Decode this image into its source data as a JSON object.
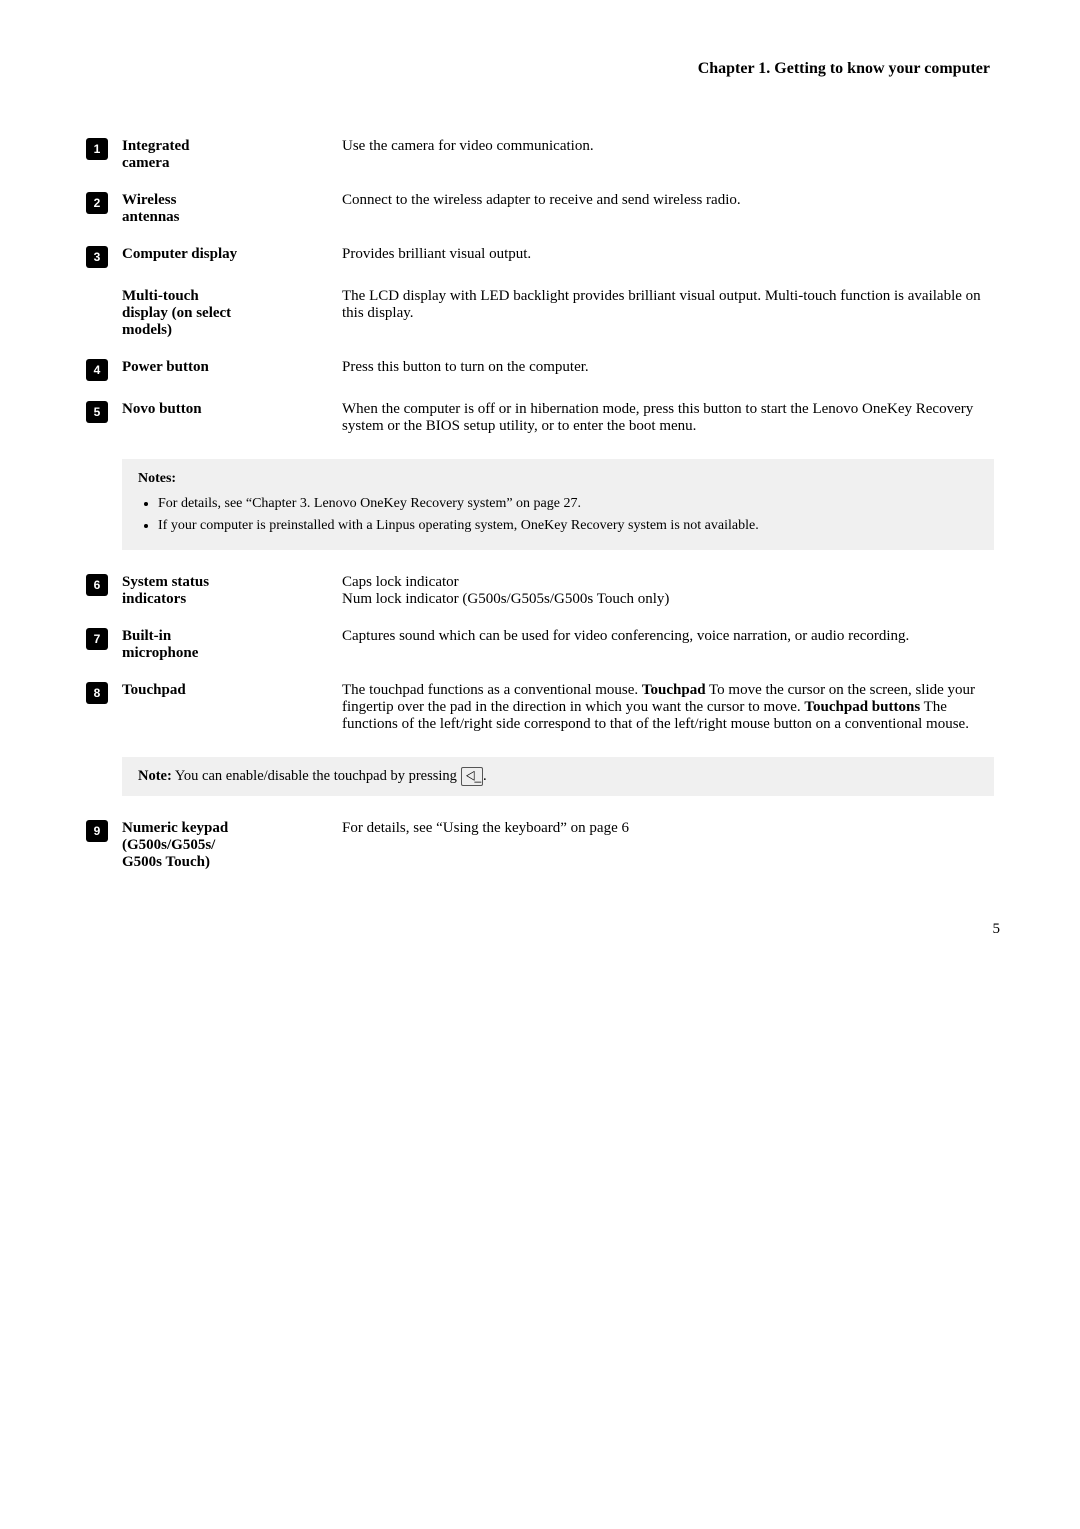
{
  "header": {
    "title": "Chapter 1. Getting to know your computer"
  },
  "items": [
    {
      "badge": "1",
      "term_line1": "Integrated",
      "term_line2": "camera",
      "desc": "Use the camera for video communication."
    },
    {
      "badge": "2",
      "term_line1": "Wireless",
      "term_line2": "antennas",
      "desc": "Connect to the wireless adapter to receive and send wireless radio."
    },
    {
      "badge": "3",
      "term_line1": "Computer display",
      "term_line2": "",
      "desc": "Provides brilliant visual output."
    },
    {
      "badge": "",
      "term_line1": "Multi-touch",
      "term_line2": "display (on select",
      "term_line3": "models)",
      "desc": "The LCD display with LED backlight provides brilliant visual output. Multi-touch function is available on this display."
    },
    {
      "badge": "4",
      "term_line1": "Power button",
      "term_line2": "",
      "desc": "Press this button to turn on the computer."
    },
    {
      "badge": "5",
      "term_line1": "Novo button",
      "term_line2": "",
      "desc": "When the computer is off or in hibernation mode, press this button to start the Lenovo OneKey Recovery system or the BIOS setup utility, or to enter the boot menu."
    }
  ],
  "notes": {
    "title": "Notes:",
    "bullets": [
      "For details, see “Chapter 3. Lenovo OneKey Recovery system” on page 27.",
      "If your computer is preinstalled with a Linpus operating system, OneKey Recovery system is not available."
    ]
  },
  "items2": [
    {
      "badge": "6",
      "term_line1": "System status",
      "term_line2": "indicators",
      "desc_line1": "Caps lock indicator",
      "desc_line2": "Num lock indicator (G500s/G505s/G500s Touch only)"
    },
    {
      "badge": "7",
      "term_line1": "Built-in",
      "term_line2": "microphone",
      "desc": "Captures sound which can be used for video conferencing, voice narration, or audio recording."
    },
    {
      "badge": "8",
      "term_line1": "Touchpad",
      "desc_parts": [
        {
          "bold": false,
          "text": "The touchpad functions as a conventional mouse."
        },
        {
          "bold": true,
          "text": "Touchpad"
        },
        {
          "bold": false,
          "text": " To move the cursor on the screen, slide your fingertip over the pad in the direction in which you want the cursor to move."
        },
        {
          "bold": true,
          "text": "Touchpad buttons"
        },
        {
          "bold": false,
          "text": " The functions of the left/right side correspond to that of the left/right mouse button on a conventional mouse."
        }
      ]
    }
  ],
  "note_inline": {
    "prefix_bold": "Note:",
    "text": " You can enable/disable the touchpad by pressing ",
    "kbd": "⨞  ̲"
  },
  "items3": [
    {
      "badge": "9",
      "term_line1": "Numeric keypad",
      "term_line2": "(G500s/G505s/",
      "term_line3": "G500s Touch)",
      "desc": "For details, see “Using the keyboard” on page 6"
    }
  ],
  "page_number": "5"
}
